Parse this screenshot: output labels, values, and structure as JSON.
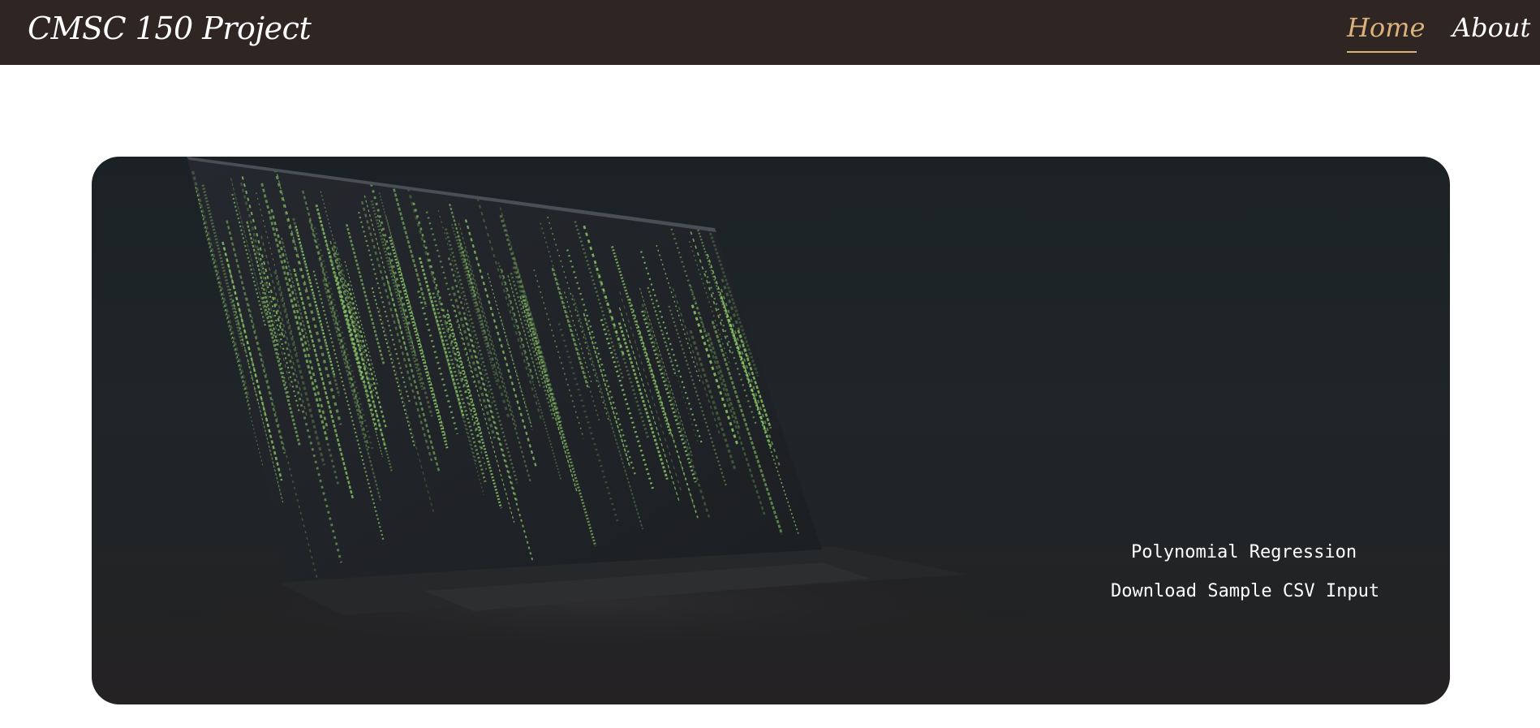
{
  "navbar": {
    "brand": "CMSC 150 Project",
    "links": [
      {
        "label": "Home",
        "active": true
      },
      {
        "label": "About",
        "active": false
      }
    ]
  },
  "hero": {
    "image": "laptop-with-green-code-rain",
    "links": [
      {
        "label": "Polynomial Regression"
      },
      {
        "label": "Download Sample CSV Input"
      }
    ]
  },
  "colors": {
    "navbar_bg": "#2f2624",
    "accent": "#d9b27c",
    "hero_bg": "#1f2528",
    "code_green": "#8fcf6b"
  }
}
